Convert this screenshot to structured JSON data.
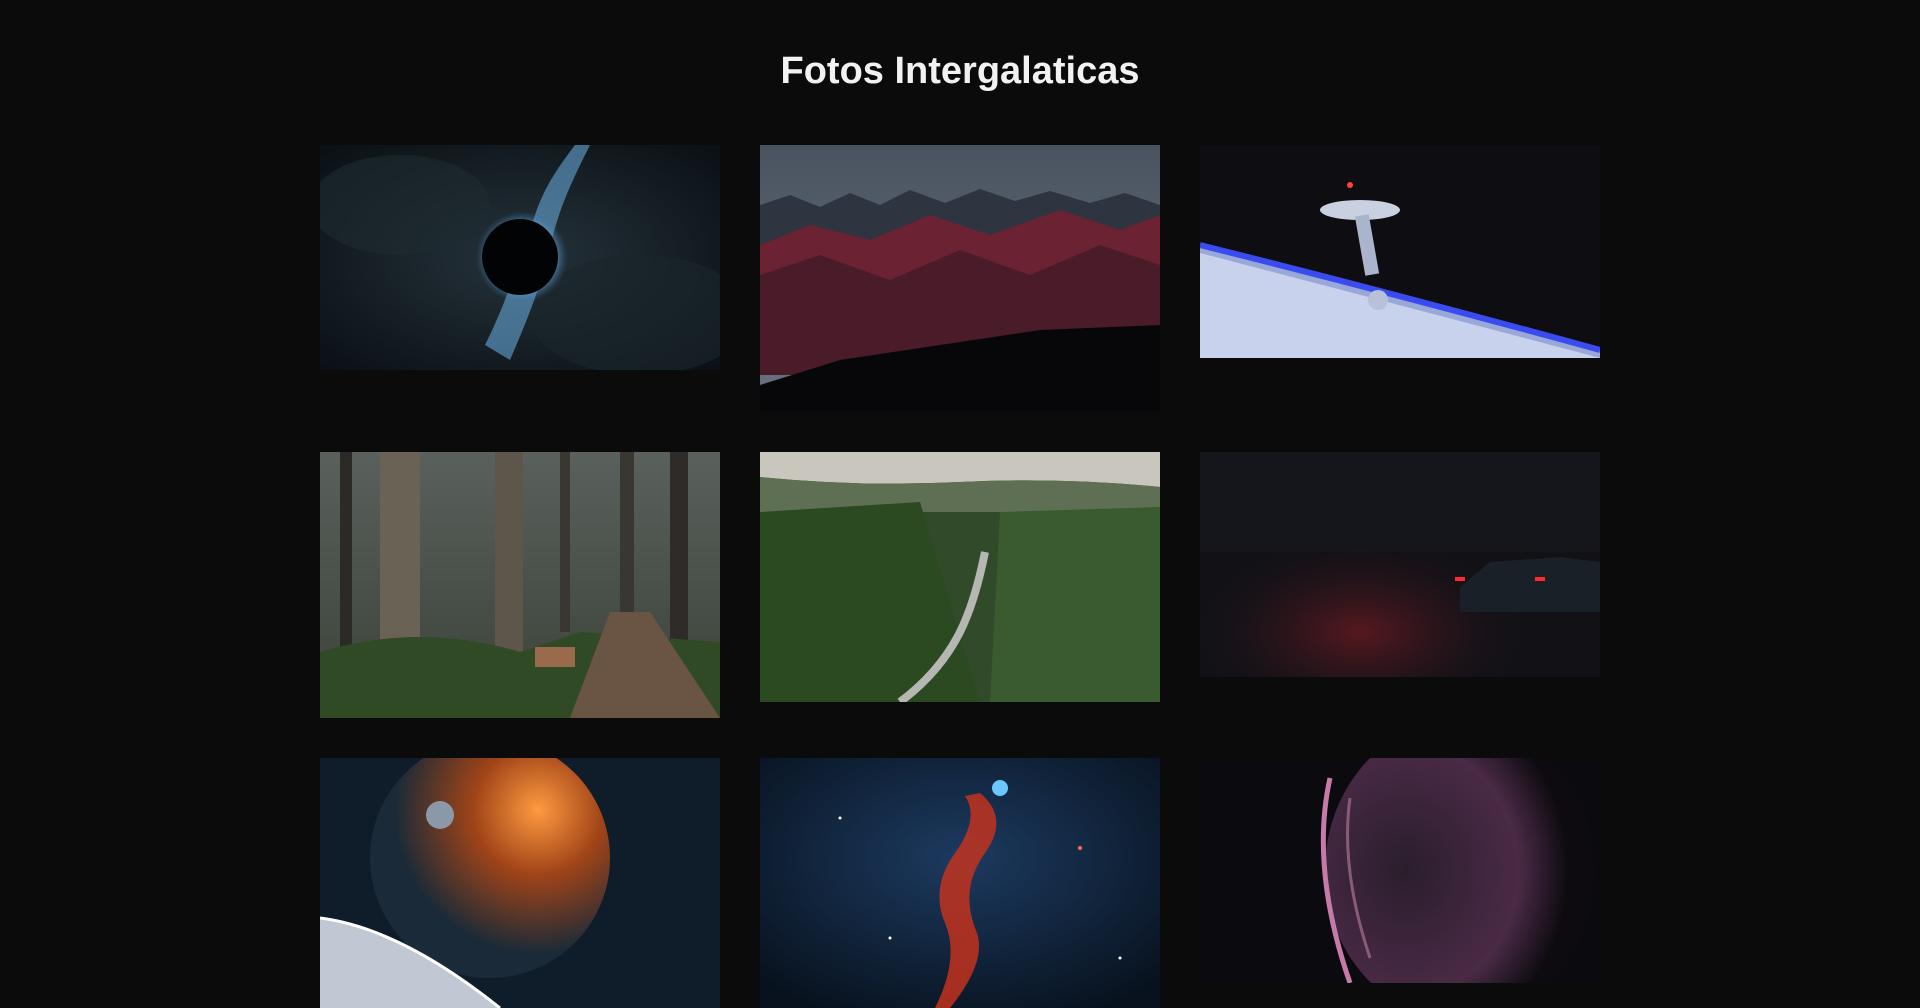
{
  "page": {
    "title": "Fotos Intergalaticas"
  },
  "gallery": {
    "photos": [
      {
        "subject": "black hole in dark nebula",
        "accent": "#7fb6e6"
      },
      {
        "subject": "red-lit mountain range under cloudy sky",
        "accent": "#8e2f3e"
      },
      {
        "subject": "space station orbiting blue planet",
        "accent": "#4a6cd8"
      },
      {
        "subject": "foggy forest trail",
        "accent": "#4d6b3c"
      },
      {
        "subject": "aerial view of winding road through pine forest",
        "accent": "#3e5f32"
      },
      {
        "subject": "car at night with red taillights",
        "accent": "#b3202a"
      },
      {
        "subject": "planets in orbit with fiery glow",
        "accent": "#ff7a2a"
      },
      {
        "subject": "red and blue space nebula",
        "accent": "#d2402a"
      },
      {
        "subject": "purple swirling planet in darkness",
        "accent": "#b06a9a"
      }
    ]
  }
}
